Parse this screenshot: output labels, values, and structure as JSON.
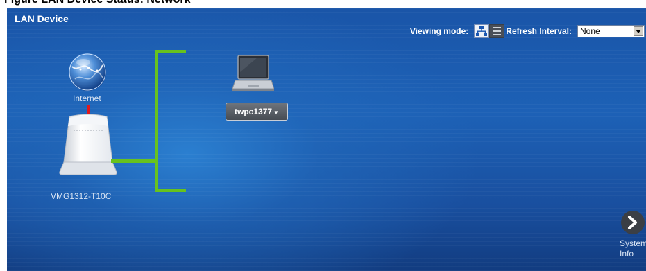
{
  "panel": {
    "title": "LAN Device"
  },
  "toolbar": {
    "viewing_mode_label": "Viewing mode:",
    "viewing_modes": [
      {
        "icon": "network-topology-icon",
        "selected": true
      },
      {
        "icon": "list-view-icon",
        "selected": false
      }
    ],
    "refresh_label": "Refresh Interval:",
    "refresh_value": "None"
  },
  "network": {
    "internet_label": "Internet",
    "gateway_label": "VMG1312-T10C",
    "devices": [
      {
        "name": "twpc1377",
        "type": "laptop"
      }
    ],
    "wan_link_color": "#e0191f",
    "lan_link_color": "#67c21e"
  },
  "system_info": {
    "label": "System\nInfo"
  }
}
